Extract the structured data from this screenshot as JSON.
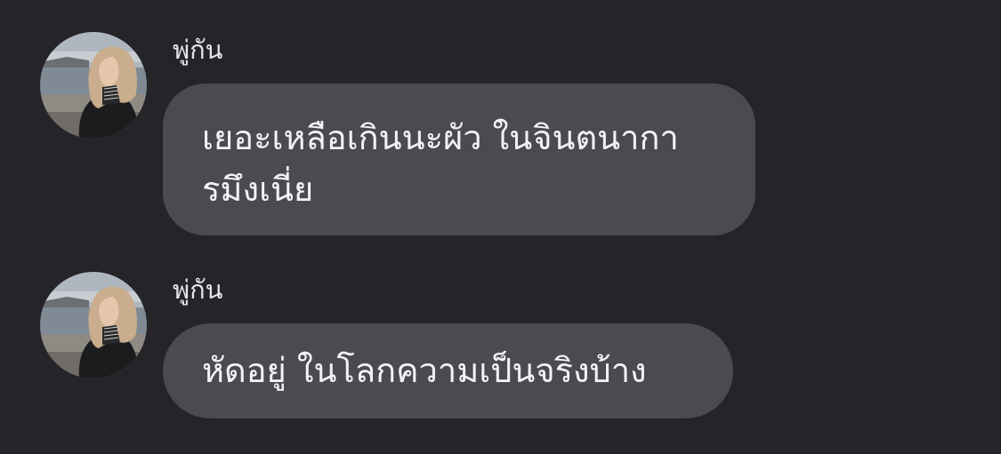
{
  "conversation": {
    "messages": [
      {
        "sender": "พู่กัน",
        "avatar_icon": "profile-photo-icon",
        "lines": [
          "เยอะเหลือเกินนะผัว ในจินตนากา",
          "รมึงเนี่ย"
        ]
      },
      {
        "sender": "พู่กัน",
        "avatar_icon": "profile-photo-icon",
        "lines": [
          "หัดอยู่ ในโลกความเป็นจริงบ้าง"
        ]
      }
    ]
  },
  "colors": {
    "background": "#242429",
    "bubble": "#4a4b51",
    "text": "#f2f3f5",
    "sender_name": "#e4e6eb"
  }
}
